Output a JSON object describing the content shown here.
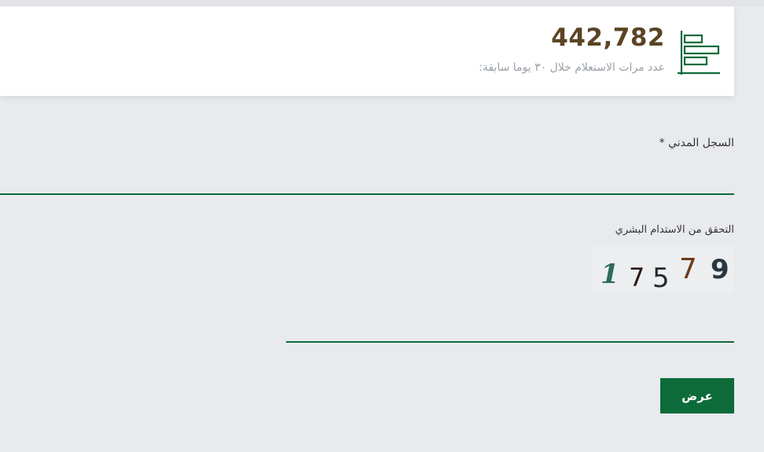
{
  "stats": {
    "icon": "bar-chart-icon",
    "value": "442,782",
    "description": "عدد مرات الاستعلام خلال ٣٠ يوما سابقة:"
  },
  "form": {
    "national_id_label": "السجل المدني *",
    "national_id_value": "",
    "captcha_label": "التحقق من الاستدام البشري",
    "captcha_digits": [
      "1",
      "7",
      "5",
      "7",
      "9"
    ],
    "captcha_value": "",
    "submit_label": "عرض"
  },
  "colors": {
    "accent": "#0d6b3a",
    "stat_value": "#5b4424",
    "muted_text": "#9aa0a6",
    "page_bg": "#e8eaee"
  }
}
